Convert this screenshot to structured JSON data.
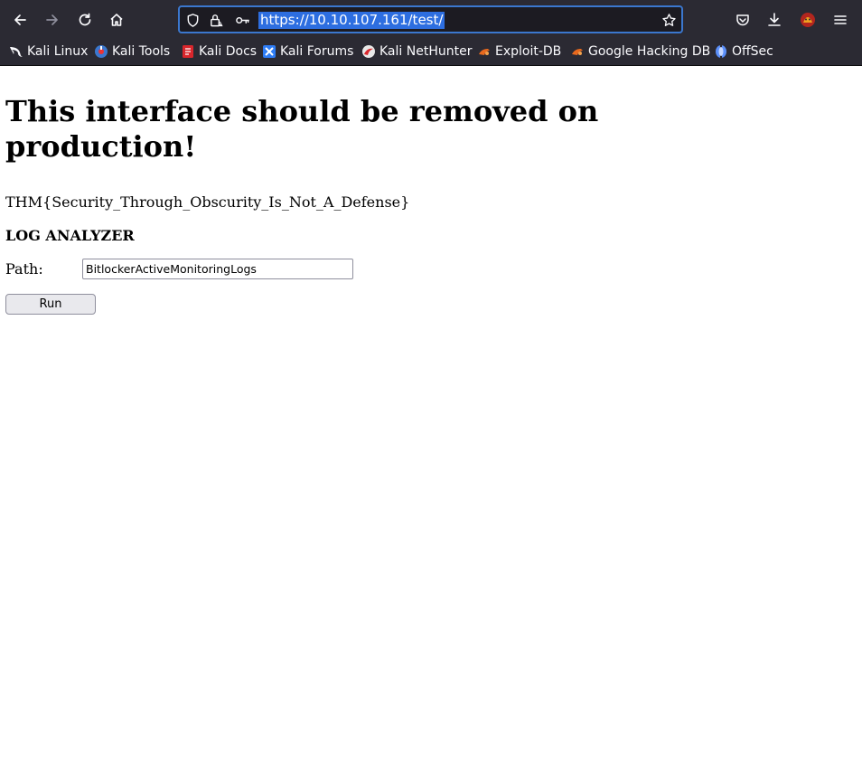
{
  "browser": {
    "url": "https://10.10.107.161/test/",
    "nav_icons": [
      "back-arrow-icon",
      "forward-arrow-icon",
      "reload-icon",
      "home-icon"
    ],
    "url_icons": [
      "shield-icon",
      "lock-warning-icon",
      "key-icon"
    ],
    "right_icons": [
      "bookmark-star-icon",
      "pocket-icon",
      "download-icon",
      "extension-avatar-icon",
      "hamburger-menu-icon"
    ],
    "colors": {
      "chrome_bg": "#2b2a33",
      "urlbar_bg": "#1c1b22",
      "urlbar_focus": "#3b77ce",
      "selection": "#2d6ee0"
    }
  },
  "bookmarks": [
    {
      "label": "Kali Linux",
      "icon": "kali-dragon-icon"
    },
    {
      "label": "Kali Tools",
      "icon": "kali-tools-icon"
    },
    {
      "label": "Kali Docs",
      "icon": "kali-docs-icon"
    },
    {
      "label": "Kali Forums",
      "icon": "kali-forums-icon"
    },
    {
      "label": "Kali NetHunter",
      "icon": "kali-nethunter-icon"
    },
    {
      "label": "Exploit-DB",
      "icon": "exploit-db-icon"
    },
    {
      "label": "Google Hacking DB",
      "icon": "exploit-db-icon"
    },
    {
      "label": "OffSec",
      "icon": "offsec-icon"
    }
  ],
  "page": {
    "heading": "This interface should be removed on production!",
    "flag": "THM{Security_Through_Obscurity_Is_Not_A_Defense}",
    "subheading": "LOG ANALYZER",
    "path_label": "Path:",
    "path_value": "BitlockerActiveMonitoringLogs",
    "run_label": "Run"
  }
}
